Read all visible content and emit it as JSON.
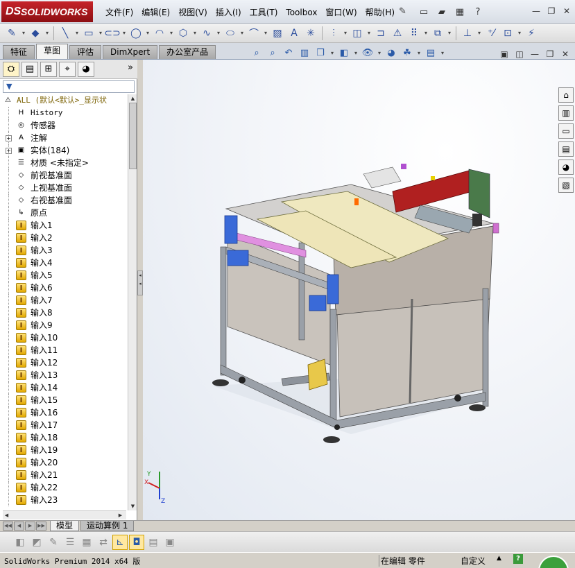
{
  "app": {
    "logo_text": "SOLIDWORKS",
    "logo_mark": "DS"
  },
  "menu": [
    {
      "label": "文件(F)",
      "name": "menu-file"
    },
    {
      "label": "编辑(E)",
      "name": "menu-edit"
    },
    {
      "label": "视图(V)",
      "name": "menu-view"
    },
    {
      "label": "插入(I)",
      "name": "menu-insert"
    },
    {
      "label": "工具(T)",
      "name": "menu-tools"
    },
    {
      "label": "Toolbox",
      "name": "menu-toolbox"
    },
    {
      "label": "窗口(W)",
      "name": "menu-window"
    },
    {
      "label": "帮助(H)",
      "name": "menu-help"
    }
  ],
  "command_tabs": [
    {
      "label": "特征",
      "name": "tab-features",
      "active": false
    },
    {
      "label": "草图",
      "name": "tab-sketch",
      "active": true
    },
    {
      "label": "评估",
      "name": "tab-evaluate",
      "active": false
    },
    {
      "label": "DimXpert",
      "name": "tab-dimxpert",
      "active": false
    },
    {
      "label": "办公室产品",
      "name": "tab-office-products",
      "active": false
    }
  ],
  "feature_tree": {
    "root": {
      "label": "ALL  (默认<默认>_显示状"
    },
    "items": [
      {
        "label": "History",
        "icon": "history-icon",
        "glyph": "H",
        "mono": true,
        "expandable": false
      },
      {
        "label": "传感器",
        "icon": "sensor-icon",
        "glyph": "◎",
        "mono": false,
        "expandable": false
      },
      {
        "label": "注解",
        "icon": "annotation-icon",
        "glyph": "A",
        "mono": false,
        "expandable": true
      },
      {
        "label": "实体(184)",
        "icon": "solid-bodies-icon",
        "glyph": "▣",
        "mono": false,
        "expandable": true
      },
      {
        "label": "材质 <未指定>",
        "icon": "material-icon",
        "glyph": "☰",
        "mono": false,
        "expandable": false
      },
      {
        "label": "前视基准面",
        "icon": "plane-icon",
        "glyph": "◇",
        "mono": false,
        "expandable": false
      },
      {
        "label": "上视基准面",
        "icon": "plane-icon",
        "glyph": "◇",
        "mono": false,
        "expandable": false
      },
      {
        "label": "右视基准面",
        "icon": "plane-icon",
        "glyph": "◇",
        "mono": false,
        "expandable": false
      },
      {
        "label": "原点",
        "icon": "origin-icon",
        "glyph": "↳",
        "mono": false,
        "expandable": false
      }
    ],
    "imports": [
      "输入1",
      "输入2",
      "输入3",
      "输入4",
      "输入5",
      "输入6",
      "输入7",
      "输入8",
      "输入9",
      "输入10",
      "输入11",
      "输入12",
      "输入13",
      "输入14",
      "输入15",
      "输入16",
      "输入17",
      "输入18",
      "输入19",
      "输入20",
      "输入21",
      "输入22",
      "输入23"
    ]
  },
  "model_tabs": [
    {
      "label": "模型",
      "name": "tab-model",
      "active": true
    },
    {
      "label": "运动算例 1",
      "name": "tab-motion-study-1",
      "active": false
    }
  ],
  "status": {
    "product": "SolidWorks Premium 2014 x64 版",
    "mode": "在编辑 零件",
    "units": "自定义",
    "up_arrow": "▲",
    "help": "?"
  },
  "triad": {
    "x": "X",
    "y": "Y",
    "z": "Z"
  },
  "colors": {
    "accent": "#c6242a",
    "panel_bg": "#d4d0c8",
    "frame_gray": "#9aa0a8",
    "panel_beige": "#efe8bf",
    "red_part": "#b02020",
    "blue_bracket": "#3a6ad8"
  }
}
